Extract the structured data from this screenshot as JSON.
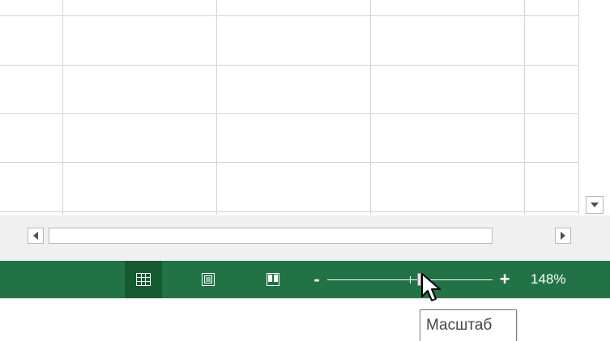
{
  "statusbar": {
    "views": [
      {
        "name": "normal-view",
        "icon": "grid-icon",
        "active": true
      },
      {
        "name": "page-layout-view",
        "icon": "page-layout-icon",
        "active": false
      },
      {
        "name": "page-break-preview",
        "icon": "page-break-icon",
        "active": false
      }
    ],
    "zoom": {
      "minus_label": "-",
      "plus_label": "+",
      "level": "148%"
    },
    "accent_color": "#217346"
  },
  "tooltip": {
    "text": "Масштаб"
  }
}
